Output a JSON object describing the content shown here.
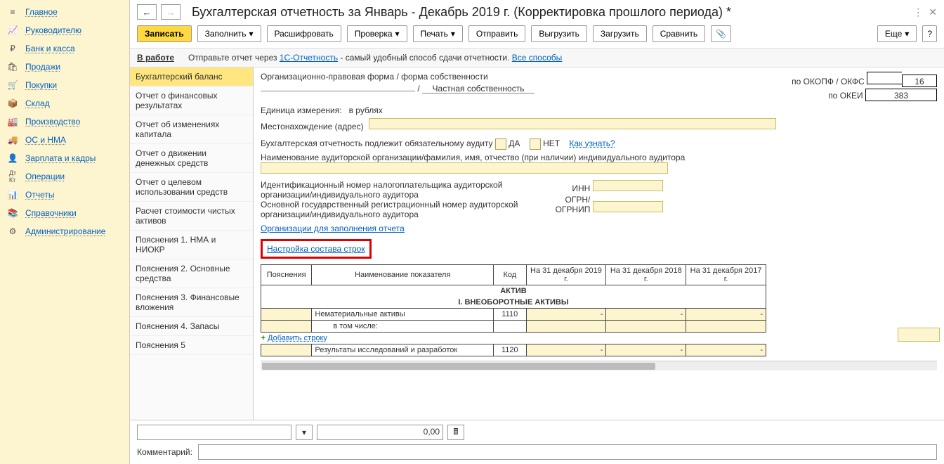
{
  "sidebar": {
    "items": [
      {
        "label": "Главное",
        "icon": "menu"
      },
      {
        "label": "Руководителю",
        "icon": "chart"
      },
      {
        "label": "Банк и касса",
        "icon": "ruble"
      },
      {
        "label": "Продажи",
        "icon": "bag"
      },
      {
        "label": "Покупки",
        "icon": "cart"
      },
      {
        "label": "Склад",
        "icon": "warehouse"
      },
      {
        "label": "Производство",
        "icon": "factory"
      },
      {
        "label": "ОС и НМА",
        "icon": "truck"
      },
      {
        "label": "Зарплата и кадры",
        "icon": "person"
      },
      {
        "label": "Операции",
        "icon": "ops"
      },
      {
        "label": "Отчеты",
        "icon": "report"
      },
      {
        "label": "Справочники",
        "icon": "book"
      },
      {
        "label": "Администрирование",
        "icon": "gear"
      }
    ]
  },
  "header": {
    "title": "Бухгалтерская отчетность за Январь - Декабрь 2019 г. (Корректировка прошлого периода) *"
  },
  "toolbar": {
    "write": "Записать",
    "fill": "Заполнить",
    "decode": "Расшифровать",
    "check": "Проверка",
    "print": "Печать",
    "send": "Отправить",
    "upload": "Выгрузить",
    "download": "Загрузить",
    "compare": "Сравнить",
    "more": "Еще"
  },
  "info": {
    "status": "В работе",
    "text_pre": "Отправьте отчет через ",
    "link1": "1С-Отчетность",
    "text_post": " - самый удобный способ сдачи отчетности. ",
    "link2": "Все способы"
  },
  "sections": {
    "items": [
      "Бухгалтерский баланс",
      "Отчет о финансовых результатах",
      "Отчет об изменениях капитала",
      "Отчет о движении денежных средств",
      "Отчет о целевом использовании средств",
      "Расчет стоимости чистых активов",
      "Пояснения 1. НМА и НИОКР",
      "Пояснения 2. Основные средства",
      "Пояснения 3. Финансовые вложения",
      "Пояснения 4. Запасы",
      "Пояснения 5"
    ]
  },
  "form": {
    "org_form_label": "Организационно-правовая форма / форма собственности",
    "ownership_label": "Частная собственность",
    "okopf_label": "по ОКОПФ / ОКФС",
    "okopf_val": "16",
    "unit_label": "Единица измерения:",
    "unit_val": "в рублях",
    "okei_label": "по ОКЕИ",
    "okei_val": "383",
    "location_label": "Местонахождение (адрес)",
    "audit_label": "Бухгалтерская отчетность подлежит обязательному аудиту",
    "yes": "ДА",
    "no": "НЕТ",
    "how_link": "Как узнать?",
    "auditor_name_label": "Наименование аудиторской организации/фамилия, имя, отчество (при наличии) индивидуального аудитора",
    "inn_block1": "Идентификационный номер налогоплательщика аудиторской организации/индивидуального аудитора",
    "inn_block2": "Основной государственный регистрационный номер аудиторской организации/индивидуального аудитора",
    "inn_label": "ИНН",
    "ogrn_label": "ОГРН/\nОГРНИП",
    "org_fill_link": "Организации для заполнения отчета",
    "rows_config_link": "Настройка состава строк"
  },
  "table": {
    "headers": [
      "Пояснения",
      "Наименование показателя",
      "Код",
      "На 31 декабря 2019 г.",
      "На 31 декабря 2018 г.",
      "На 31 декабря 2017 г."
    ],
    "asset_title": "АКТИВ",
    "section1_title": "I. ВНЕОБОРОТНЫЕ АКТИВЫ",
    "row1_name": "Нематериальные активы",
    "row1_code": "1110",
    "row1_sub": "в том числе:",
    "add_row": "Добавить строку",
    "row2_name": "Результаты исследований и разработок",
    "row2_code": "1120"
  },
  "footer": {
    "num_value": "0,00",
    "comment_label": "Комментарий:"
  }
}
